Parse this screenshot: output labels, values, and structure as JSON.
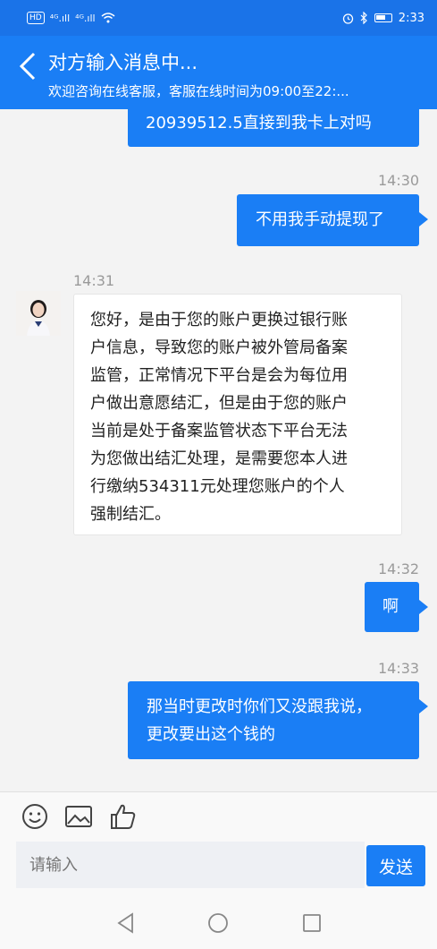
{
  "status_bar": {
    "hd": "HD",
    "sig1": "⁴ᴳ.ıll",
    "sig2": "⁴ᴳ.ıll",
    "time": "2:33"
  },
  "header": {
    "title": "对方输入消息中...",
    "subtitle": "欢迎咨询在线客服，客服在线时间为09:00至22:..."
  },
  "messages": [
    {
      "side": "right",
      "text": "20939512.5直接到我卡上对吗"
    },
    {
      "time": "14:30"
    },
    {
      "side": "right",
      "text": "不用我手动提现了"
    },
    {
      "time": "14:31"
    },
    {
      "side": "left",
      "lines": [
        "您好，是由于您的账户更换过银行账",
        "户信息，导致您的账户被外管局备案",
        "监管，正常情况下平台是会为每位用",
        "户做出意愿结汇，但是由于您的账户",
        "当前是处于备案监管状态下平台无法",
        "为您做出结汇处理，是需要您本人进",
        "行缴纳534311元处理您账户的个人",
        "强制结汇。"
      ]
    },
    {
      "time": "14:32"
    },
    {
      "side": "right",
      "text": "啊"
    },
    {
      "time": "14:33"
    },
    {
      "side": "right",
      "lines": [
        "那当时更改时你们又没跟我说，",
        "更改要出这个钱的"
      ]
    }
  ],
  "input": {
    "placeholder": "请输入",
    "send_label": "发送"
  },
  "icons": [
    "emoji-icon",
    "image-icon",
    "thumbs-up-icon"
  ],
  "colors": {
    "accent": "#1a7ef5",
    "status_bar": "#1a73e8"
  }
}
